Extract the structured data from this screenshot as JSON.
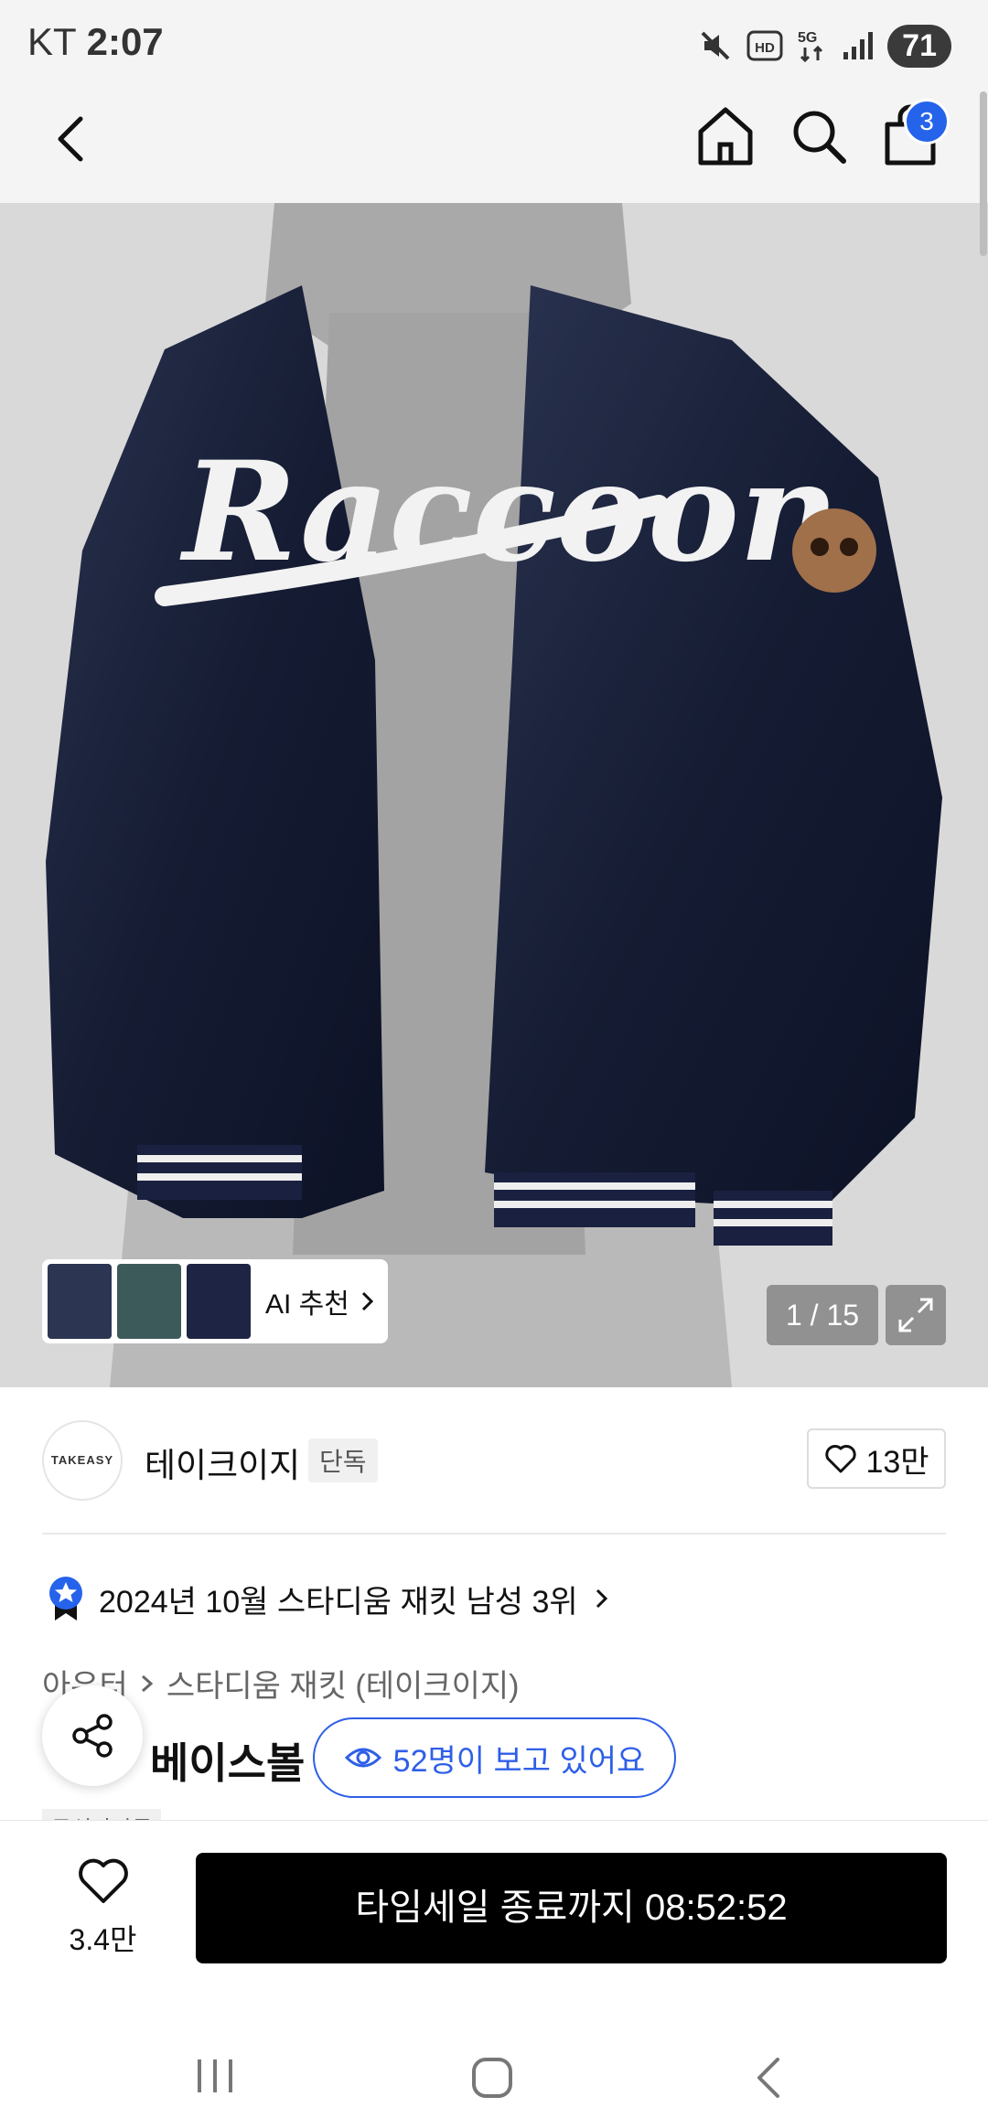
{
  "status_bar": {
    "carrier": "KT",
    "time": "2:07",
    "battery": "71"
  },
  "header": {
    "cart_count": "3"
  },
  "gallery": {
    "counter": "1 / 15",
    "ai_label": "AI 추천"
  },
  "brand": {
    "logo_text": "TAKEASY",
    "name": "테이크이지",
    "badge": "단독",
    "likes": "13만"
  },
  "ranking": {
    "text": "2024년 10월 스타디움 재킷 남성 3위"
  },
  "breadcrumb": {
    "category": "아우터",
    "subcategory": "스타디움 재킷 (테이크이지)"
  },
  "product": {
    "title_fragment": "베이스볼",
    "tag": "무신사단독"
  },
  "viewers": {
    "text": "52명이 보고 있어요"
  },
  "bottom_bar": {
    "wish_count": "3.4만",
    "buy_label": "타임세일 종료까지 08:52:52"
  }
}
